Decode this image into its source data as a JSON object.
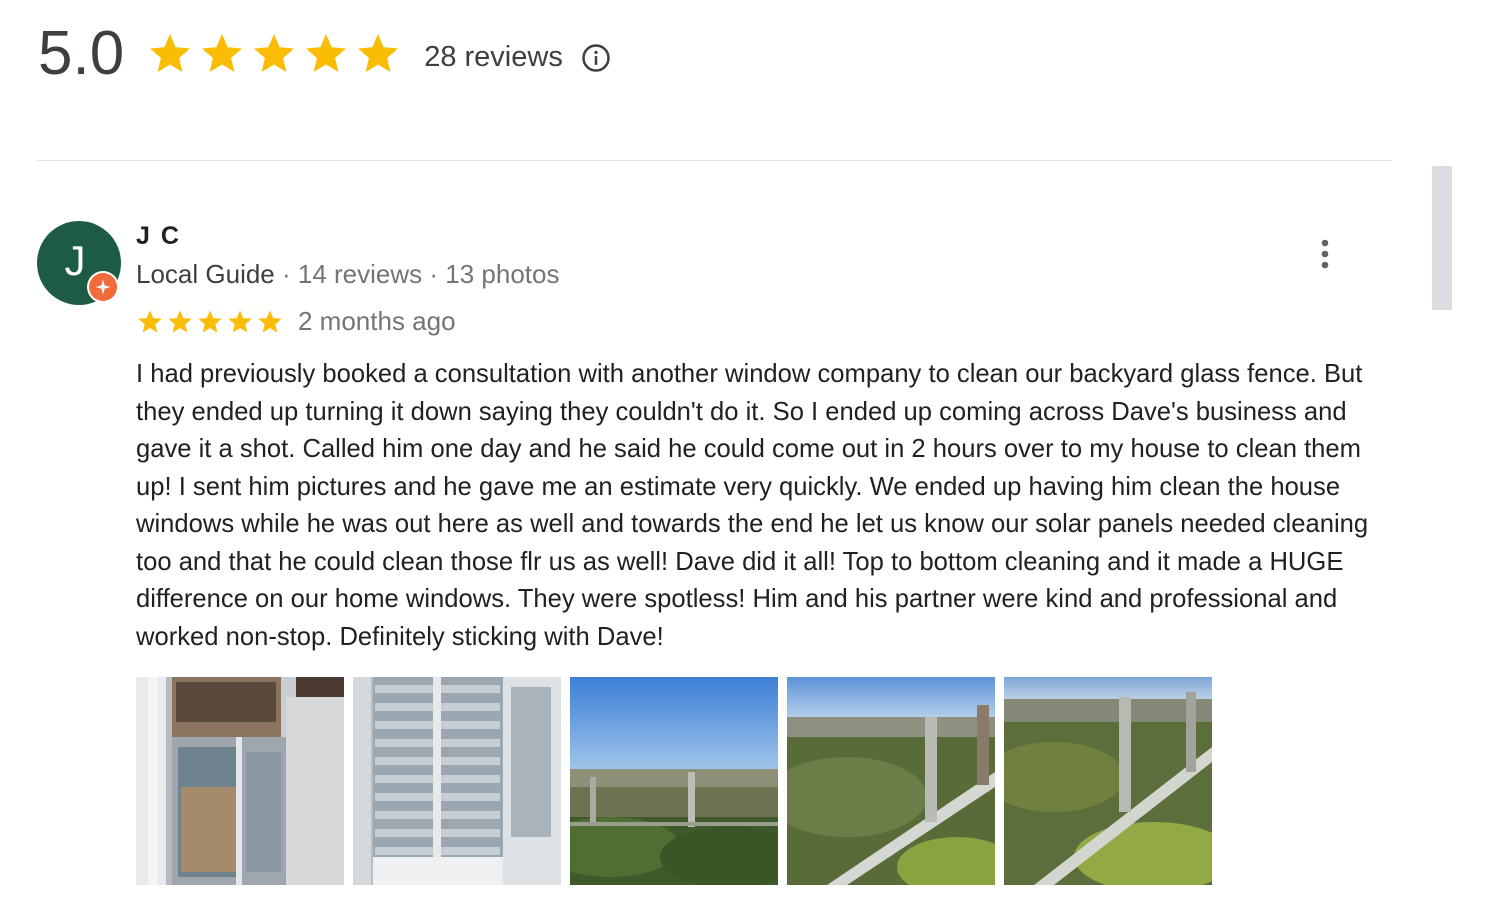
{
  "summary": {
    "rating": "5.0",
    "stars": 5,
    "review_count_label": "28 reviews",
    "info_icon": "info-icon"
  },
  "review": {
    "avatar_letter": "J",
    "reviewer_name": "J C",
    "guide_label": "Local Guide",
    "meta_separator": " · ",
    "reviews_count": "14 reviews",
    "photos_count": "13 photos",
    "stars": 5,
    "date": "2 months ago",
    "text": "I had previously booked a consultation with another window company to clean our backyard glass fence. But they ended up turning it down saying they couldn't do it. So I ended up coming across Dave's business and gave it a shot. Called him one day and he said he could come out in 2 hours over to my house to clean them up! I sent him pictures and he gave me an estimate very quickly. We ended up having him clean the house windows while he was out here as well and towards the end he let us know our solar panels needed cleaning too and that he could clean those flr us as well! Dave did it all! Top to bottom cleaning and it made a HUGE difference on our home windows. They were spotless! Him and his partner were kind and professional and worked non-stop. Definitely sticking with Dave!",
    "photos": [
      {
        "name": "photo-window-exterior"
      },
      {
        "name": "photo-window-blinds"
      },
      {
        "name": "photo-backyard-view"
      },
      {
        "name": "photo-glass-fence-1"
      },
      {
        "name": "photo-glass-fence-2"
      }
    ]
  },
  "colors": {
    "star": "#fbbc04",
    "avatar_bg": "#1e5b45",
    "badge": "#f26b3a",
    "secondary_text": "#70757a"
  }
}
